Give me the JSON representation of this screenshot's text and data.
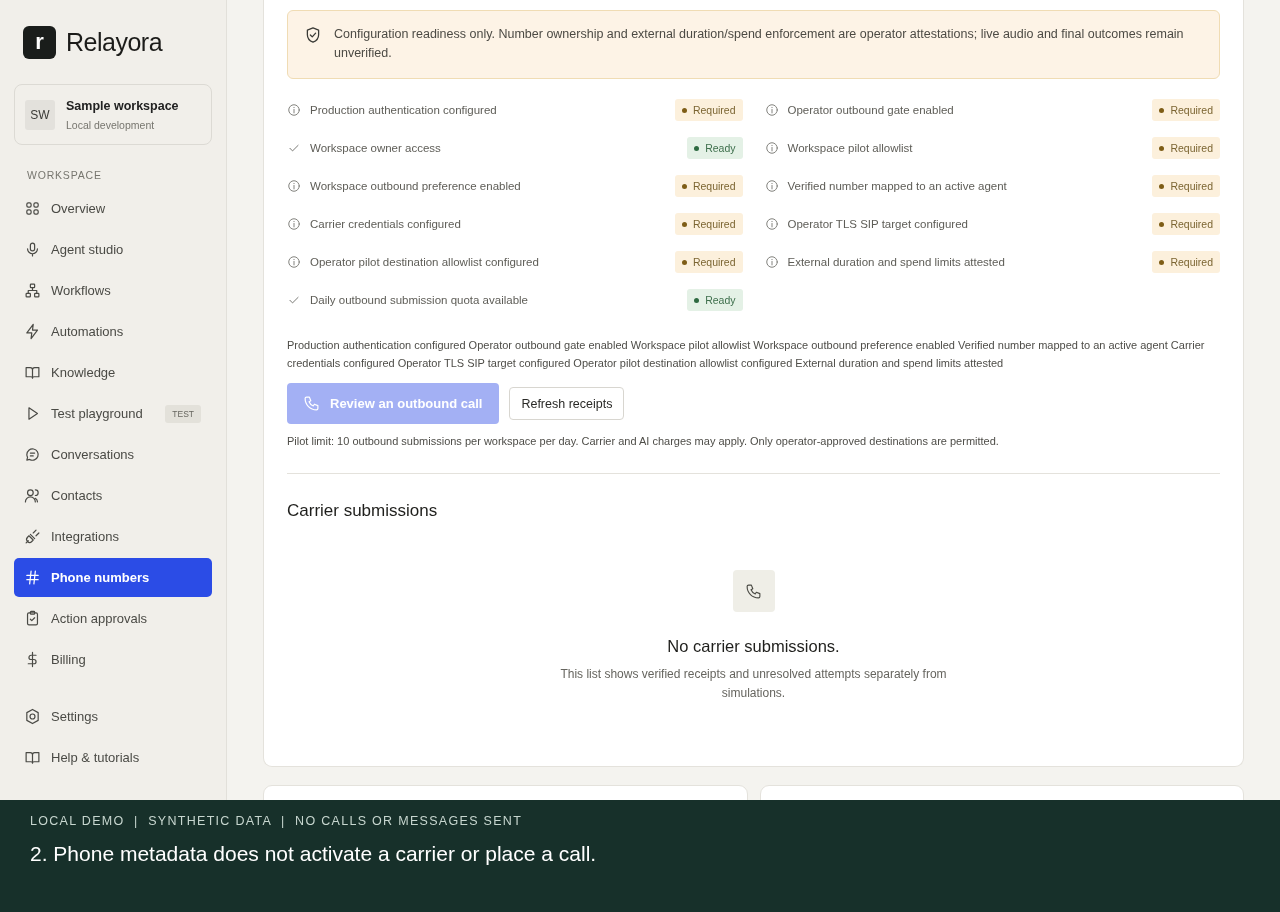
{
  "brand": {
    "logo_letter": "r",
    "name": "Relayora"
  },
  "workspace": {
    "initials": "SW",
    "name": "Sample workspace",
    "subtitle": "Local development"
  },
  "sidebar": {
    "section_label": "WORKSPACE",
    "items": [
      {
        "label": "Overview",
        "selected": false
      },
      {
        "label": "Agent studio",
        "selected": false
      },
      {
        "label": "Workflows",
        "selected": false
      },
      {
        "label": "Automations",
        "selected": false
      },
      {
        "label": "Knowledge",
        "selected": false
      },
      {
        "label": "Test playground",
        "selected": false,
        "badge": "TEST"
      },
      {
        "label": "Conversations",
        "selected": false
      },
      {
        "label": "Contacts",
        "selected": false
      },
      {
        "label": "Integrations",
        "selected": false
      },
      {
        "label": "Phone numbers",
        "selected": true
      },
      {
        "label": "Action approvals",
        "selected": false
      },
      {
        "label": "Billing",
        "selected": false
      }
    ],
    "footer_items": [
      {
        "label": "Settings",
        "selected": false
      },
      {
        "label": "Help & tutorials",
        "selected": false
      }
    ]
  },
  "notice": "Configuration readiness only. Number ownership and external duration/spend enforcement are operator attestations; live audio and final outcomes remain unverified.",
  "checklist": {
    "columns": [
      [
        {
          "label": "Production authentication configured",
          "kind": "required",
          "badge": "Required"
        },
        {
          "label": "Workspace owner access",
          "kind": "ready",
          "badge": "Ready"
        },
        {
          "label": "Workspace outbound preference enabled",
          "kind": "required",
          "badge": "Required"
        },
        {
          "label": "Carrier credentials configured",
          "kind": "required",
          "badge": "Required"
        },
        {
          "label": "Operator pilot destination allowlist configured",
          "kind": "required",
          "badge": "Required"
        },
        {
          "label": "Daily outbound submission quota available",
          "kind": "ready",
          "badge": "Ready"
        }
      ],
      [
        {
          "label": "Operator outbound gate enabled",
          "kind": "required",
          "badge": "Required"
        },
        {
          "label": "Workspace pilot allowlist",
          "kind": "required",
          "badge": "Required"
        },
        {
          "label": "Verified number mapped to an active agent",
          "kind": "required",
          "badge": "Required"
        },
        {
          "label": "Operator TLS SIP target configured",
          "kind": "required",
          "badge": "Required"
        },
        {
          "label": "External duration and spend limits attested",
          "kind": "required",
          "badge": "Required"
        }
      ]
    ]
  },
  "missing_summary": "Production authentication configured Operator outbound gate enabled Workspace pilot allowlist Workspace outbound preference enabled Verified number mapped to an active agent Carrier credentials configured Operator TLS SIP target configured Operator pilot destination allowlist configured External duration and spend limits attested",
  "actions": {
    "primary": {
      "label": "Review an outbound call",
      "disabled": true
    },
    "secondary": {
      "label": "Refresh receipts"
    }
  },
  "pilot_note": "Pilot limit: 10 outbound submissions per workspace per day. Carrier and AI charges may apply. Only operator-approved destinations are permitted.",
  "submissions": {
    "title": "Carrier submissions",
    "empty_title": "No carrier submissions.",
    "empty_text": "This list shows verified receipts and unresolved attempts separately from simulations."
  },
  "demo_banner": {
    "tag": "LOCAL DEMO  |  SYNTHETIC DATA  |  NO CALLS OR MESSAGES SENT",
    "caption": "2. Phone metadata does not activate a carrier or place a call."
  }
}
